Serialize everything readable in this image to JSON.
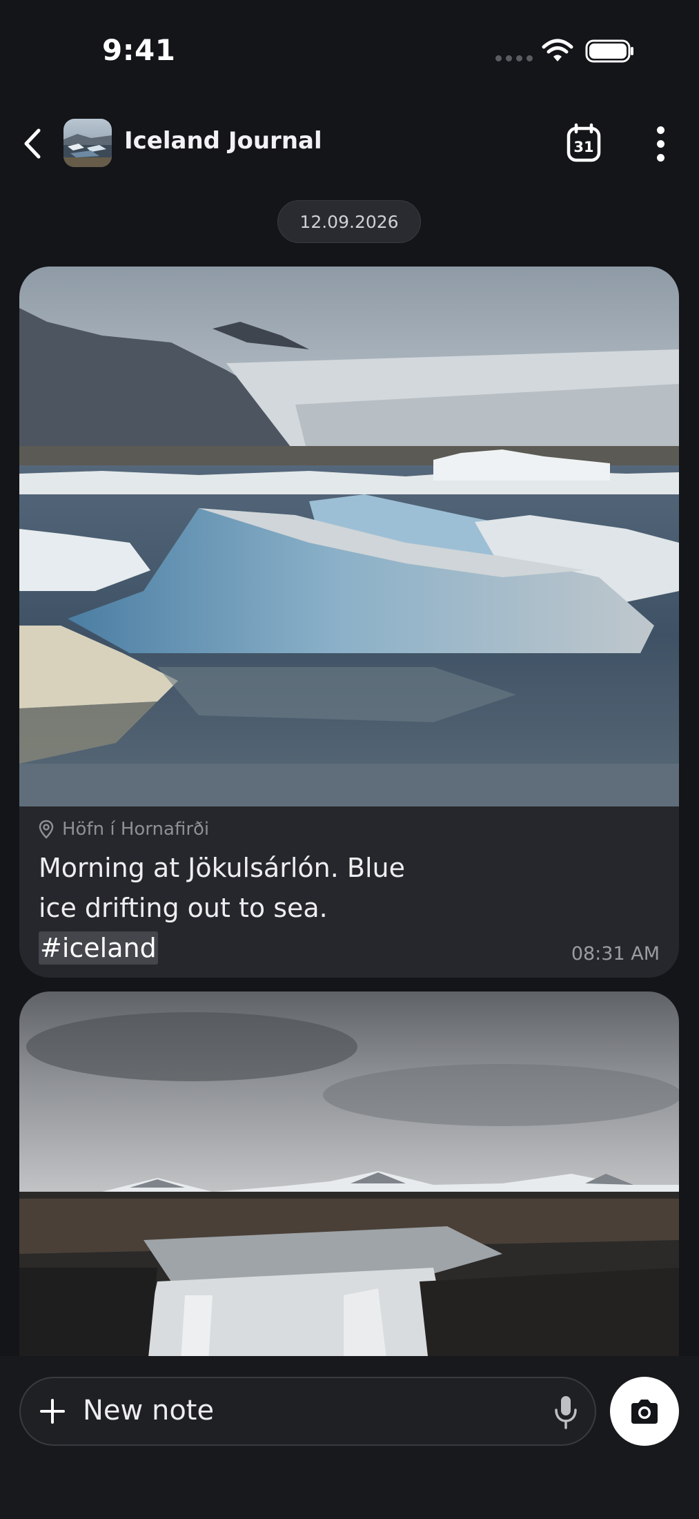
{
  "status_bar": {
    "time": "9:41"
  },
  "header": {
    "title": "Iceland Journal",
    "calendar_day": "31",
    "icons": [
      "back-chevron-icon",
      "calendar-icon",
      "more-vertical-icon"
    ]
  },
  "date_chip": "12.09.2026",
  "messages": [
    {
      "location": "Höfn í Hornafirði",
      "caption_text": "Morning at Jökulsárlón. Blue ice drifting out to sea.",
      "hashtag": "#iceland",
      "time": "08:31 AM"
    }
  ],
  "composer": {
    "placeholder": "New note",
    "icons": [
      "plus-icon",
      "microphone-icon",
      "camera-icon"
    ]
  }
}
